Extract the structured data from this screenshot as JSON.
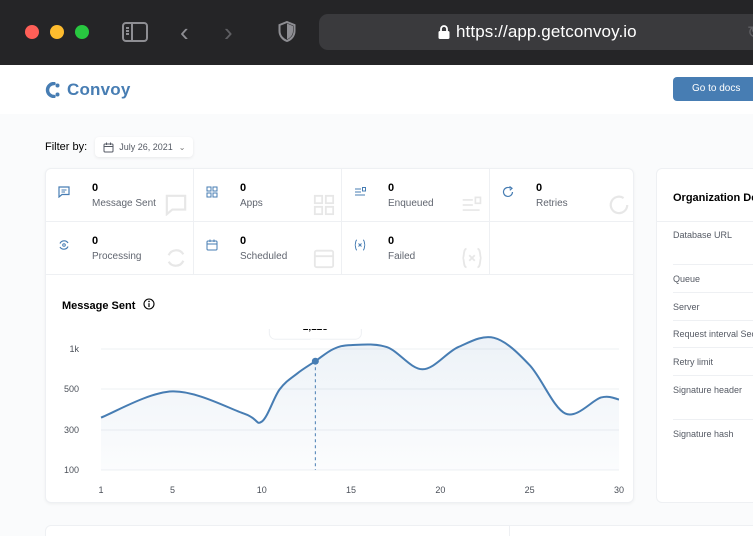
{
  "browser": {
    "url": "https://app.getconvoy.io"
  },
  "header": {
    "brand": "Convoy",
    "docs_button": "Go to docs"
  },
  "filter": {
    "label": "Filter by:",
    "date": "July 26, 2021"
  },
  "stats": [
    {
      "value": "0",
      "label": "Message Sent",
      "icon": "message-icon"
    },
    {
      "value": "0",
      "label": "Apps",
      "icon": "grid-icon"
    },
    {
      "value": "0",
      "label": "Enqueued",
      "icon": "queue-icon"
    },
    {
      "value": "0",
      "label": "Retries",
      "icon": "retry-icon"
    },
    {
      "value": "0",
      "label": "Processing",
      "icon": "processing-icon"
    },
    {
      "value": "0",
      "label": "Scheduled",
      "icon": "calendar-icon"
    },
    {
      "value": "0",
      "label": "Failed",
      "icon": "failed-icon"
    }
  ],
  "chart_section": {
    "title": "Message Sent"
  },
  "chart_data": {
    "type": "area",
    "title": "Message Sent",
    "y_ticks": [
      "1k",
      "500",
      "300",
      "100"
    ],
    "x_ticks": [
      "1",
      "5",
      "10",
      "15",
      "20",
      "25",
      "30"
    ],
    "x": [
      1,
      5,
      9,
      10,
      11,
      12,
      13,
      14,
      15,
      17,
      19,
      21,
      23,
      25,
      27,
      29,
      30
    ],
    "y_levels": [
      1.3,
      1.95,
      1.4,
      1.2,
      2.0,
      2.4,
      2.7,
      3.0,
      3.1,
      3.05,
      2.5,
      3.05,
      3.28,
      2.6,
      1.4,
      1.8,
      1.75
    ],
    "y_level_note_labels": [
      "100",
      "300",
      "500",
      "1k"
    ],
    "highlight": {
      "x": 13,
      "label": "2,123"
    },
    "line_color": "#477db3"
  },
  "organization": {
    "title": "Organization Details",
    "rows": [
      "Database URL",
      "Queue",
      "Server",
      "Request interval Seconds",
      "Retry limit",
      "Signature header",
      "Signature hash"
    ]
  }
}
